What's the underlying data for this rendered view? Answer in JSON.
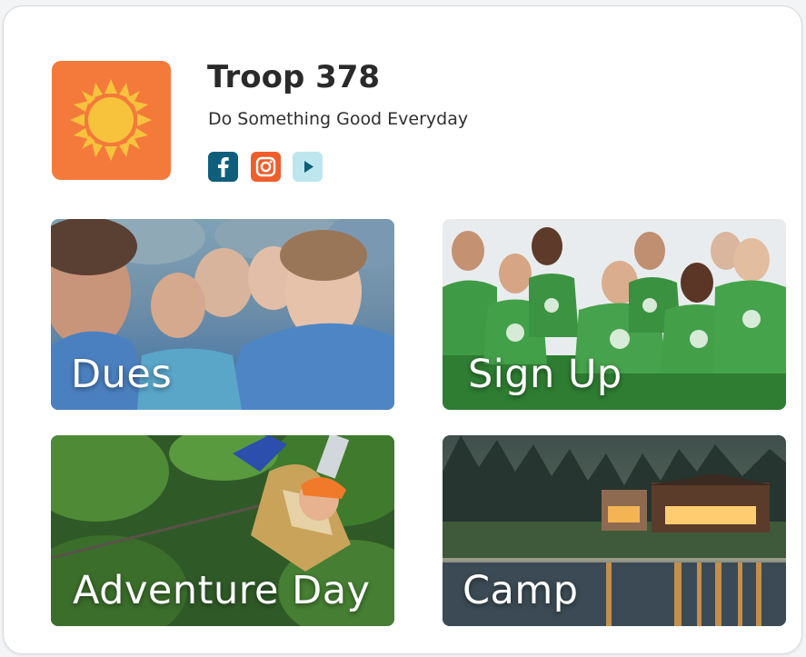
{
  "troop": {
    "name": "Troop 378",
    "tagline": "Do Something Good Everyday",
    "logo_icon": "sun-icon",
    "logo_color": "#f47a3b"
  },
  "social": [
    {
      "name": "facebook",
      "icon": "facebook-icon",
      "color": "#0f5f7c"
    },
    {
      "name": "instagram",
      "icon": "instagram-icon",
      "color": "#ee5f2c"
    },
    {
      "name": "youtube",
      "icon": "play-icon",
      "color": "#bde6ee"
    }
  ],
  "tiles": [
    {
      "label": "Dues"
    },
    {
      "label": "Sign Up"
    },
    {
      "label": "Adventure Day"
    },
    {
      "label": "Camp"
    }
  ]
}
